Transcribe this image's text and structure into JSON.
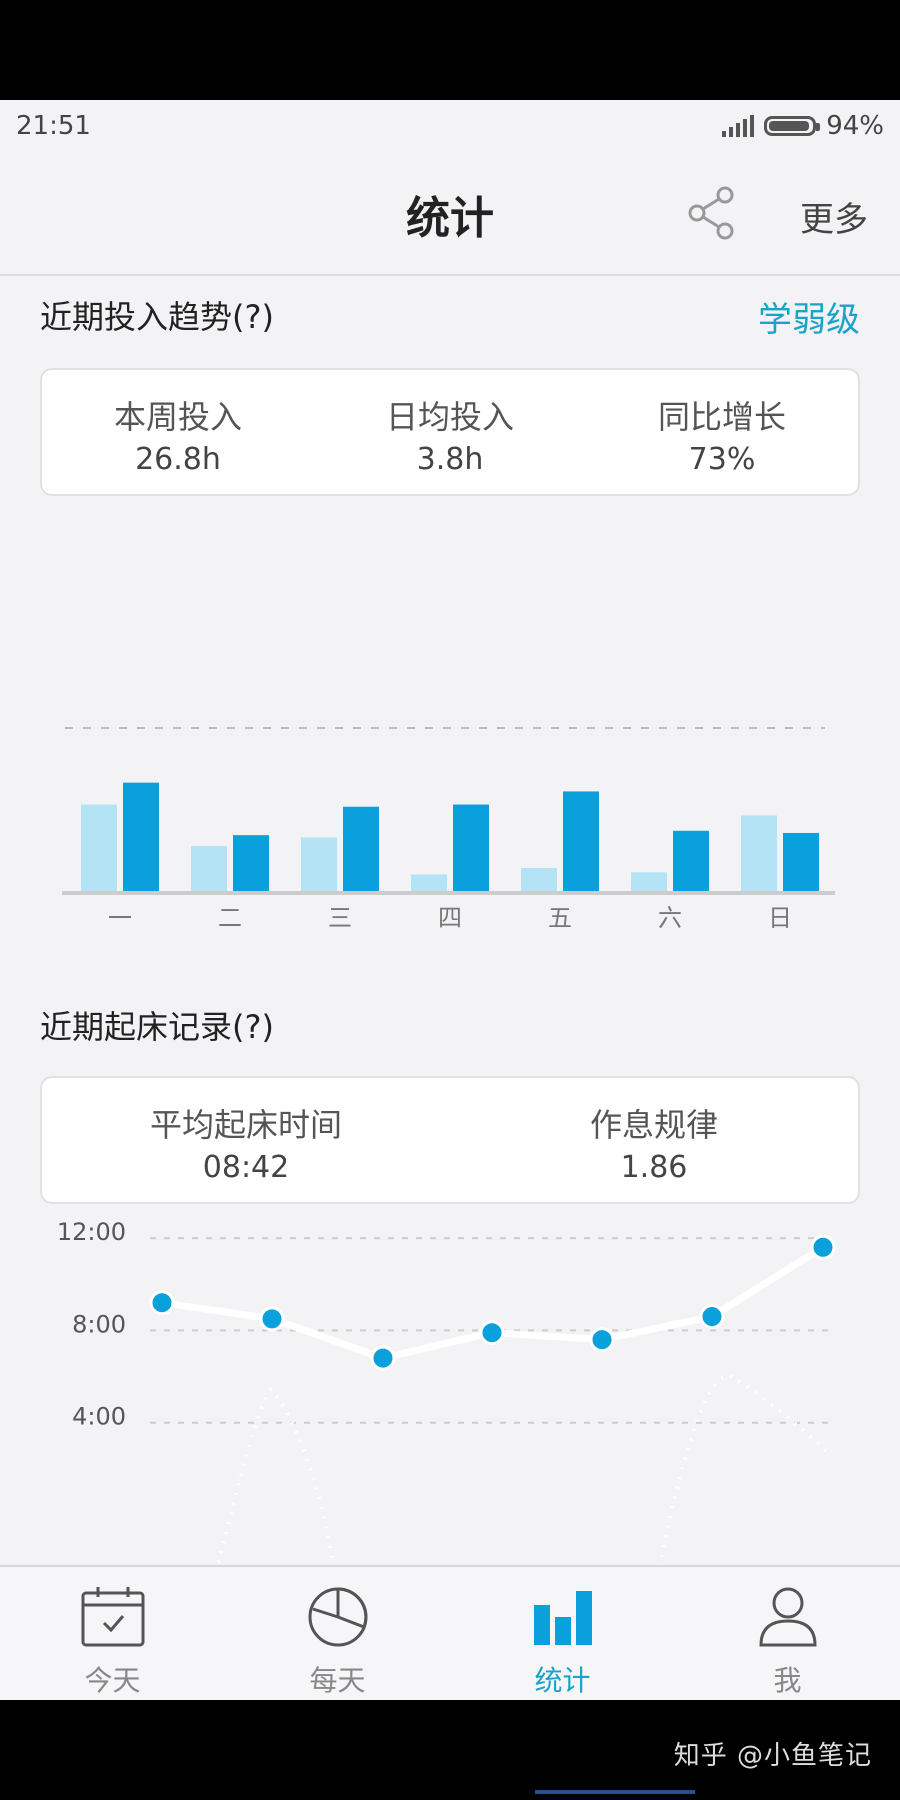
{
  "status_bar": {
    "time": "21:51",
    "battery_text": "94%",
    "battery_level": 0.94
  },
  "header": {
    "title": "统计",
    "share_icon": "share-icon",
    "more_label": "更多"
  },
  "trend": {
    "title": "近期投入趋势(?)",
    "level_label": "学弱级",
    "stats": [
      {
        "label": "本周投入",
        "value": "26.8h"
      },
      {
        "label": "日均投入",
        "value": "3.8h"
      },
      {
        "label": "同比增长",
        "value": "73%"
      }
    ]
  },
  "wake": {
    "title": "近期起床记录(?)",
    "stats": [
      {
        "label": "平均起床时间",
        "value": "08:42"
      },
      {
        "label": "作息规律",
        "value": "1.86"
      }
    ]
  },
  "chart_data": [
    {
      "type": "bar",
      "title": "",
      "categories": [
        "一",
        "二",
        "三",
        "四",
        "五",
        "六",
        "日"
      ],
      "series": [
        {
          "values": [
            4.0,
            2.1,
            2.5,
            0.8,
            1.1,
            0.9,
            3.5
          ],
          "color": "#b3e3f5"
        },
        {
          "values": [
            5.0,
            2.6,
            3.9,
            4.0,
            4.6,
            2.8,
            2.7
          ],
          "color": "#0aa0dc"
        }
      ],
      "ylim": [
        0,
        7.5
      ],
      "grid": "dashed reference line at top",
      "legend": "none"
    },
    {
      "type": "line",
      "title": "",
      "ytick_labels": [
        "12:00",
        "8:00",
        "4:00"
      ],
      "ylim_hours": [
        0,
        13
      ],
      "series": [
        {
          "values": [
            9.2,
            8.5,
            6.8,
            7.9,
            7.6,
            8.6,
            11.6
          ],
          "color": "#0aa0dc"
        }
      ],
      "grid": "dashed horizontal lines",
      "legend": "none"
    }
  ],
  "bottom_nav": [
    {
      "label": "今天",
      "icon": "calendar-check-icon",
      "active": false
    },
    {
      "label": "每天",
      "icon": "pie-chart-icon",
      "active": false
    },
    {
      "label": "统计",
      "icon": "bar-chart-icon",
      "active": true
    },
    {
      "label": "我",
      "icon": "person-icon",
      "active": false
    }
  ],
  "watermark": "知乎 @小鱼笔记"
}
